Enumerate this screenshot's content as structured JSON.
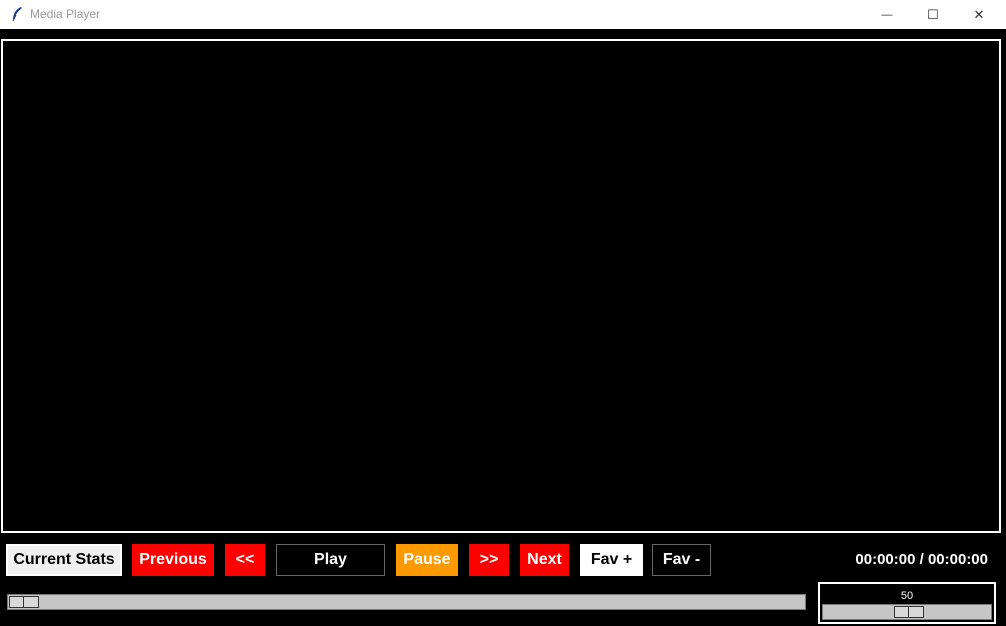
{
  "window": {
    "title": "Media Player",
    "minimize_glyph": "—",
    "maximize_glyph": "☐",
    "close_glyph": "✕"
  },
  "controls": {
    "current_stats": "Current Stats",
    "previous": "Previous",
    "rewind": "<<",
    "play": "Play",
    "pause": "Pause",
    "forward": ">>",
    "next": "Next",
    "fav_add": "Fav +",
    "fav_remove": "Fav -"
  },
  "time_display": "00:00:00 / 00:00:00",
  "progress": {
    "value": 0
  },
  "volume": {
    "value": "50",
    "max": 100
  },
  "colors": {
    "red": "#ff0000",
    "orange": "#ff9900",
    "white": "#ffffff",
    "black": "#000000",
    "light_gray": "#f0f0f0"
  }
}
